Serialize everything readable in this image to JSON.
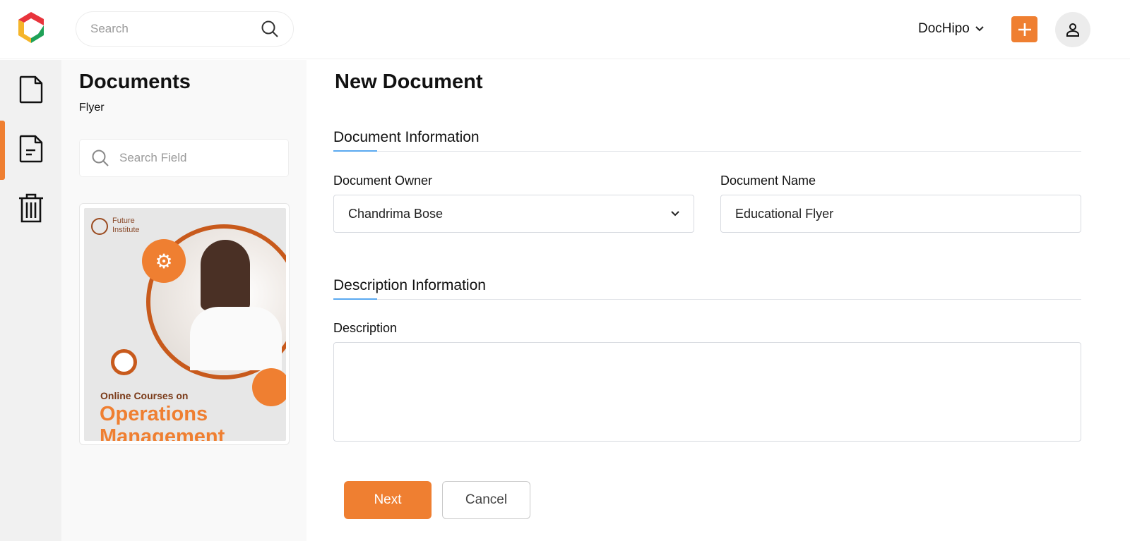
{
  "header": {
    "search_placeholder": "Search",
    "account_name": "DocHipo",
    "icons": {
      "logo": "dochipo-logo",
      "search": "search-icon",
      "chevron": "chevron-down-icon",
      "add": "plus-icon",
      "user": "user-icon"
    }
  },
  "colors": {
    "accent": "#ef7f31",
    "section_underline": "#5aa9f0"
  },
  "rail": {
    "items": [
      {
        "icon": "file-icon"
      },
      {
        "icon": "document-text-icon",
        "active": true
      },
      {
        "icon": "trash-icon"
      }
    ]
  },
  "panel": {
    "title": "Documents",
    "subtitle": "Flyer",
    "search_placeholder": "Search Field",
    "template": {
      "brand_line1": "Future",
      "brand_line2": "Institute",
      "line1": "Online Courses on",
      "line2": "Operations",
      "line3": "Management"
    }
  },
  "main": {
    "title": "New Document",
    "section1": "Document Information",
    "owner_label": "Document Owner",
    "owner_value": "Chandrima Bose",
    "name_label": "Document Name",
    "name_value": "Educational Flyer",
    "section2": "Description Information",
    "description_label": "Description",
    "description_value": "",
    "next_label": "Next",
    "cancel_label": "Cancel"
  }
}
